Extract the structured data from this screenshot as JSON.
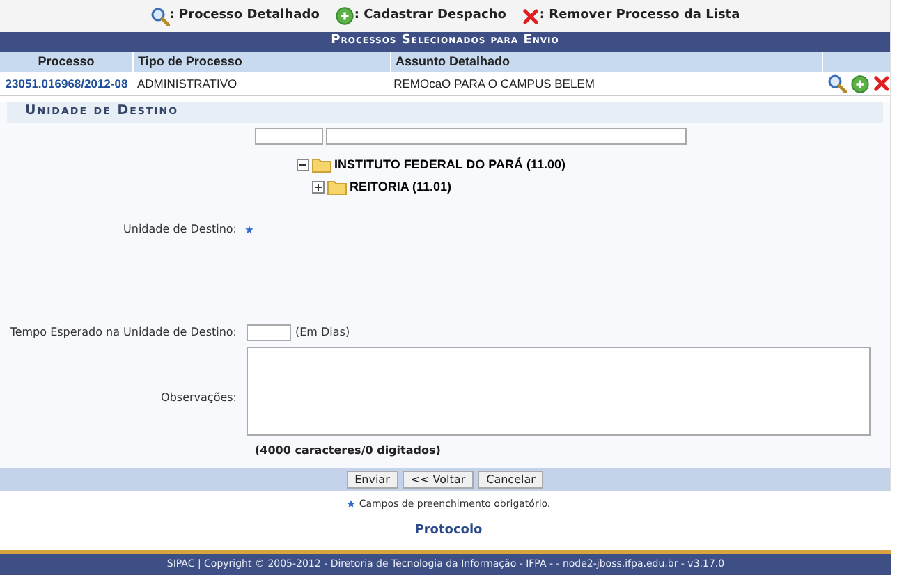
{
  "legend": [
    {
      "kind": "view",
      "label": ": Processo Detalhado"
    },
    {
      "kind": "add",
      "label": ": Cadastrar Despacho"
    },
    {
      "kind": "remove",
      "label": ": Remover Processo da Lista"
    }
  ],
  "table": {
    "title": "Processos Selecionados para Envio",
    "columns": [
      "Processo",
      "Tipo de Processo",
      "Assunto Detalhado"
    ],
    "rows": [
      {
        "processo": "23051.016968/2012-08",
        "tipo": "ADMINISTRATIVO",
        "assunto": "REMOcaO PARA O CAMPUS BELEM"
      }
    ]
  },
  "form": {
    "title": "Unidade de Destino",
    "tree": [
      {
        "label": "INSTITUTO FEDERAL DO PARÁ (11.00)",
        "expanded": true,
        "children": [
          {
            "label": "REITORIA (11.01)",
            "expanded": false
          }
        ]
      }
    ],
    "unidade_label": "Unidade de Destino:",
    "tempo_label": "Tempo Esperado na Unidade de Destino:",
    "tempo_unit": "(Em Dias)",
    "obs_label": "Observações:",
    "counter": "(4000 caracteres/0 digitados)",
    "buttons": [
      "Enviar",
      "<< Voltar",
      "Cancelar"
    ]
  },
  "required_note": "Campos de preenchimento obrigatório.",
  "module_link": "Protocolo",
  "footer": "SIPAC | Copyright © 2005-2012 - Diretoria de Tecnologia da Informação - IFPA - - node2-jboss.ifpa.edu.br - v3.17.0"
}
